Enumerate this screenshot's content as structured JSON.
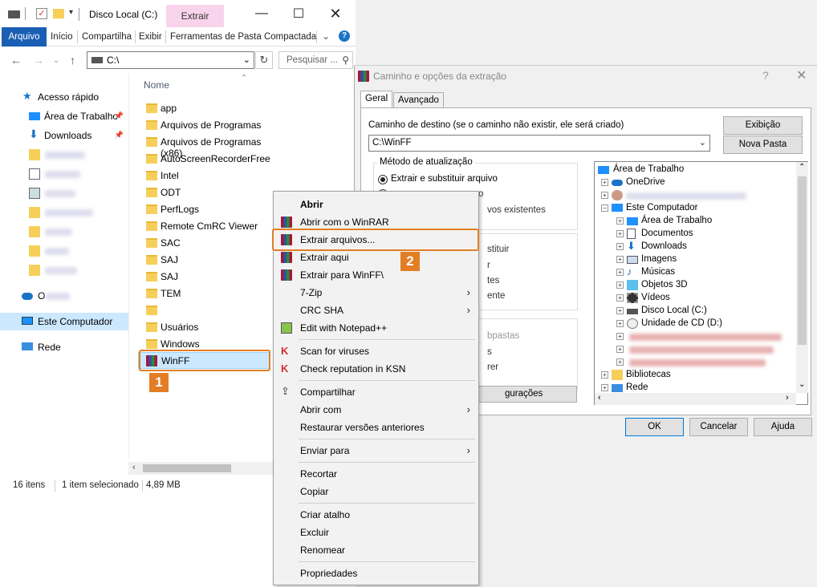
{
  "explorer": {
    "title": "Disco Local (C:)",
    "context_tab": "Extrair",
    "ribbon_tabs": [
      "Arquivo",
      "Início",
      "Compartilha",
      "Exibir",
      "Ferramentas de Pasta Compactada"
    ],
    "address": "C:\\",
    "search_placeholder": "Pesquisar ...",
    "column_header": "Nome",
    "nav": {
      "quick_access": "Acesso rápido",
      "desktop": "Área de Trabalho",
      "downloads": "Downloads",
      "onedrive_prefix": "O",
      "this_pc": "Este Computador",
      "network": "Rede"
    },
    "files": [
      "app",
      "Arquivos de Programas",
      "Arquivos de Programas (x86)",
      "AutoScreenRecorderFree",
      "Intel",
      "ODT",
      "PerfLogs",
      "Remote CmRC Viewer",
      "SAC",
      "SAJ",
      "SAJ",
      "TEM",
      "",
      "Usuários",
      "Windows",
      "WinFF"
    ],
    "status": {
      "count": "16 itens",
      "selected": "1 item selecionado",
      "size": "4,89 MB"
    }
  },
  "callouts": {
    "one": "1",
    "two": "2"
  },
  "context_menu": {
    "items": [
      {
        "label": "Abrir",
        "bold": true
      },
      {
        "label": "Abrir com o WinRAR"
      },
      {
        "label": "Extrair arquivos..."
      },
      {
        "label": "Extrair aqui"
      },
      {
        "label": "Extrair para WinFF\\"
      },
      {
        "label": "7-Zip"
      },
      {
        "label": "CRC SHA"
      },
      {
        "label": "Edit with Notepad++"
      },
      {
        "label": "Scan for viruses"
      },
      {
        "label": "Check reputation in KSN"
      },
      {
        "label": "Compartilhar"
      },
      {
        "label": "Abrir com"
      },
      {
        "label": "Restaurar versões anteriores"
      },
      {
        "label": "Enviar para"
      },
      {
        "label": "Recortar"
      },
      {
        "label": "Copiar"
      },
      {
        "label": "Criar atalho"
      },
      {
        "label": "Excluir"
      },
      {
        "label": "Renomear"
      },
      {
        "label": "Propriedades"
      }
    ]
  },
  "dialog": {
    "title": "Caminho e opções da extração",
    "help": "?",
    "tabs": [
      "Geral",
      "Avançado"
    ],
    "dest_label": "Caminho de destino (se o caminho não existir, ele será criado)",
    "dest_value": "C:\\WinFF",
    "btn_view": "Exibição",
    "btn_new_folder": "Nova Pasta",
    "update_group": "Método de atualização",
    "update_opt1": "Extrair e substituir arquivo",
    "frag_a": "o",
    "frag_b": "vos existentes",
    "frag_c": "stituir",
    "frag_d": "r",
    "frag_e": "tes",
    "frag_f": "ente",
    "frag_g": "bpastas",
    "frag_h": "s",
    "frag_i": "rer",
    "frag_save": "gurações",
    "tree": [
      "Área de Trabalho",
      "OneDrive",
      "Este Computador",
      "Área de Trabalho",
      "Documentos",
      "Downloads",
      "Imagens",
      "Músicas",
      "Objetos 3D",
      "Vídeos",
      "Disco Local (C:)",
      "Unidade de CD (D:)",
      "Bibliotecas",
      "Rede"
    ],
    "ok": "OK",
    "cancel": "Cancelar",
    "help_btn": "Ajuda"
  }
}
